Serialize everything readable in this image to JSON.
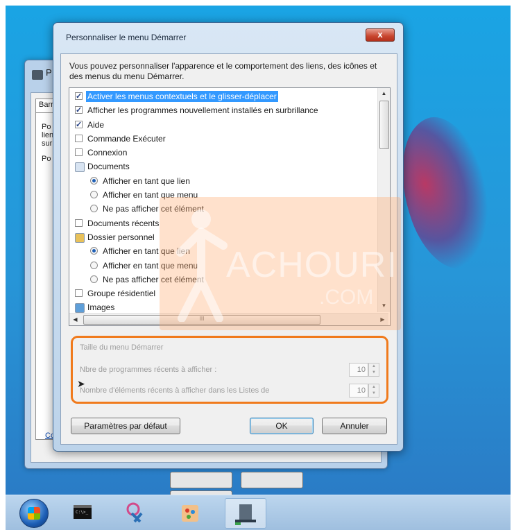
{
  "background_window": {
    "title_fragment": "P",
    "tab_fragment": "Barr",
    "text_fragments": [
      "Po",
      "lien",
      "sur",
      "Po"
    ],
    "link_fragment": "Co"
  },
  "dialog": {
    "title": "Personnaliser le menu Démarrer",
    "close_symbol": "x",
    "description": "Vous pouvez personnaliser l'apparence et le comportement des liens, des icônes et des menus du menu Démarrer.",
    "list_items": [
      {
        "kind": "checkbox",
        "checked": true,
        "indent": 0,
        "label": "Activer les menus contextuels et le glisser-déplacer",
        "selected": true
      },
      {
        "kind": "checkbox",
        "checked": true,
        "indent": 0,
        "label": "Afficher les programmes nouvellement installés en surbrillance"
      },
      {
        "kind": "checkbox",
        "checked": true,
        "indent": 0,
        "label": "Aide"
      },
      {
        "kind": "checkbox",
        "checked": false,
        "indent": 0,
        "label": "Commande Exécuter"
      },
      {
        "kind": "checkbox",
        "checked": false,
        "indent": 0,
        "label": "Connexion"
      },
      {
        "kind": "icon",
        "icon": "documents-icon",
        "indent": 0,
        "label": "Documents"
      },
      {
        "kind": "radio",
        "checked": true,
        "indent": 1,
        "label": "Afficher en tant que lien"
      },
      {
        "kind": "radio",
        "checked": false,
        "indent": 1,
        "label": "Afficher en tant que menu"
      },
      {
        "kind": "radio",
        "checked": false,
        "indent": 1,
        "label": "Ne pas afficher cet élément"
      },
      {
        "kind": "checkbox",
        "checked": false,
        "indent": 0,
        "label": "Documents récents"
      },
      {
        "kind": "icon",
        "icon": "user-folder-icon",
        "indent": 0,
        "label": "Dossier personnel"
      },
      {
        "kind": "radio",
        "checked": true,
        "indent": 1,
        "label": "Afficher en tant que lien"
      },
      {
        "kind": "radio",
        "checked": false,
        "indent": 1,
        "label": "Afficher en tant que menu"
      },
      {
        "kind": "radio",
        "checked": false,
        "indent": 1,
        "label": "Ne pas afficher cet élément"
      },
      {
        "kind": "checkbox",
        "checked": false,
        "indent": 0,
        "label": "Groupe résidentiel"
      },
      {
        "kind": "icon",
        "icon": "images-icon",
        "indent": 0,
        "label": "Images"
      }
    ],
    "scroll_grip": "III",
    "size_group": {
      "title": "Taille du menu Démarrer",
      "recent_programs_label": "Nbre de programmes récents à afficher :",
      "recent_programs_value": "10",
      "recent_items_label": "Nombre d'éléments récents à afficher dans les Listes de",
      "recent_items_value": "10"
    },
    "buttons": {
      "defaults": "Paramètres par défaut",
      "ok": "OK",
      "cancel": "Annuler"
    }
  },
  "watermark": {
    "text": "ACHOURI",
    "sub": ".COM"
  },
  "taskbar": {
    "items": [
      "start-orb",
      "cmd-icon",
      "snipping-tool-icon",
      "paint-icon",
      "properties-window-icon"
    ]
  },
  "colors": {
    "highlight": "#f07a1c",
    "selection": "#3399ff"
  }
}
